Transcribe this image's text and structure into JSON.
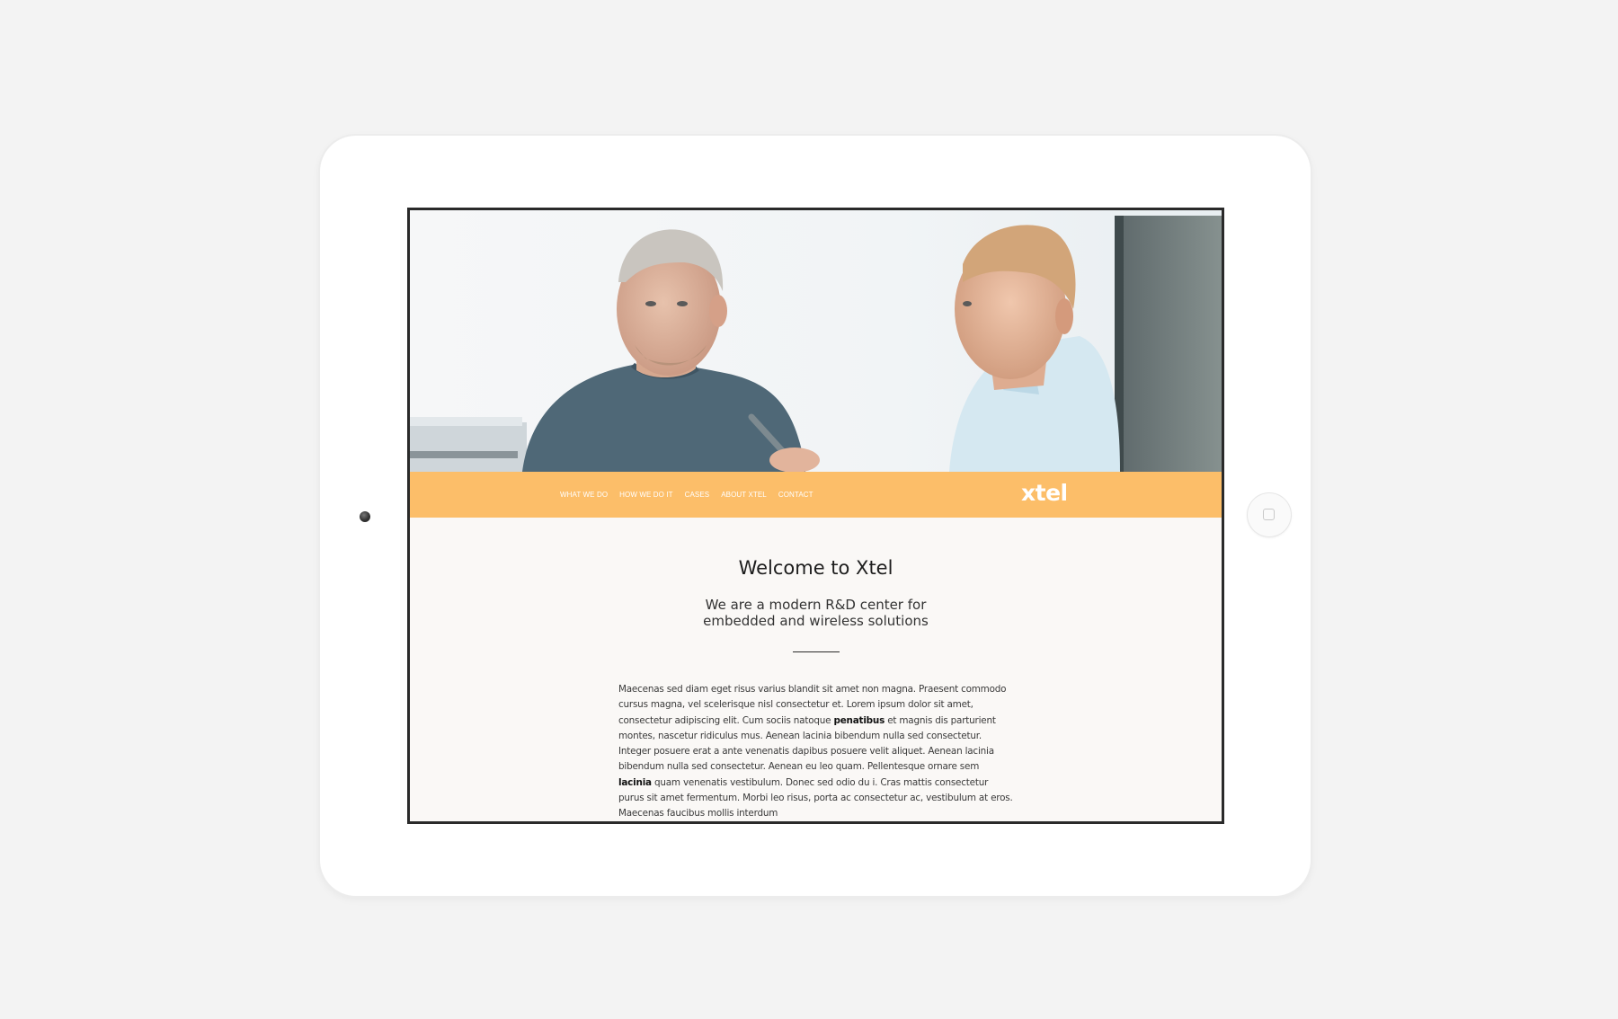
{
  "nav": {
    "items": [
      "WHAT WE DO",
      "HOW WE DO IT",
      "CASES",
      "ABOUT XTEL",
      "CONTACT"
    ],
    "logo": "xtel"
  },
  "hero": {
    "image": "two engineers looking at a computer screen"
  },
  "main": {
    "title": "Welcome to Xtel",
    "subtitle_line1": "We are a modern R&D center for",
    "subtitle_line2": "embedded and wireless solutions",
    "p1_a": "Maecenas sed diam eget risus varius blandit sit amet non magna. Praesent commodo cursus magna, vel scelerisque nisl consectetur et. Lorem ipsum dolor sit amet, consectetur adipiscing elit. Cum sociis natoque ",
    "p1_bold": "penatibus",
    "p1_b": " et magnis dis parturient montes, nascetur ridiculus mus. Aenean lacinia bibendum nulla sed consectetur.",
    "p2_a": "Integer posuere erat a ante venenatis dapibus posuere velit aliquet. Aenean lacinia bibendum nulla sed consectetur. Aenean eu leo quam. Pellentesque ornare sem ",
    "p2_bold": "lacinia",
    "p2_b": " quam venenatis vestibulum. Donec sed odio du i. Cras mattis consectetur purus sit amet fermentum. Morbi leo risus, porta ac consectetur ac, vestibulum at eros. Maecenas faucibus mollis interdum"
  },
  "colors": {
    "accent": "#fcbe69",
    "background": "#f3f3f3",
    "screen_bg": "#faf8f6"
  }
}
